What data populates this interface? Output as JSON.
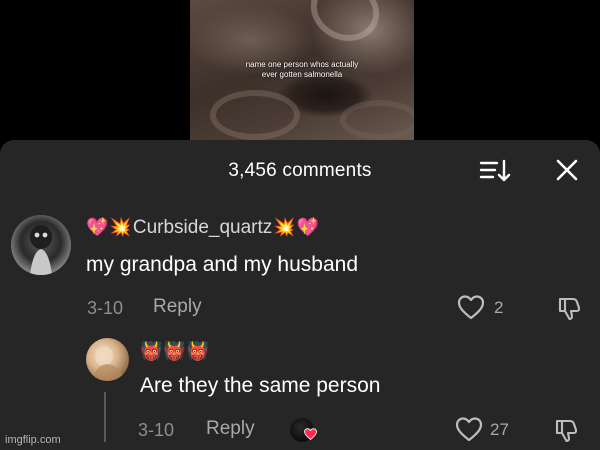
{
  "video": {
    "caption_line1": "name one person whos actually",
    "caption_line2": "ever gotten salmonella"
  },
  "header": {
    "comment_count_label": "3,456 comments",
    "sort_icon": "sort-descending-icon",
    "close_icon": "close-icon"
  },
  "comments": [
    {
      "username": "Curbside_quartz",
      "username_prefix_emoji": [
        "💖",
        "💥"
      ],
      "username_suffix_emoji": [
        "💥",
        "💖"
      ],
      "text": "my grandpa and my husband",
      "date": "3-10",
      "reply_label": "Reply",
      "like_count": "2"
    },
    {
      "username_emoji": [
        "👹",
        "👹",
        "👹"
      ],
      "text": "Are they the same person",
      "date": "3-10",
      "reply_label": "Reply",
      "like_count": "27",
      "liked_by_creator": true
    }
  ],
  "watermark": "imgflip.com",
  "colors": {
    "panel_bg": "#262626",
    "text_primary": "#ffffff",
    "text_secondary": "#8e8e8e",
    "heart_red": "#ff2b55"
  }
}
